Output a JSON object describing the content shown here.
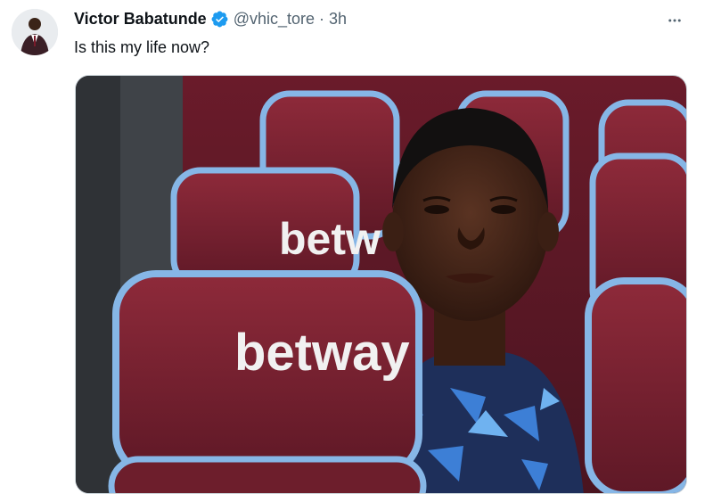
{
  "author": {
    "display_name": "Victor Babatunde",
    "handle": "@vhic_tore",
    "separator": "·",
    "timestamp": "3h",
    "verified_icon": "verified-badge-icon",
    "avatar": "avatar"
  },
  "tweet": {
    "text": "Is this my life now?"
  },
  "media": {
    "description_icon": "media-photo",
    "seat_branding_front": "betway",
    "seat_branding_back": "betw"
  },
  "more_icon": "more-dots-icon",
  "colors": {
    "verified_blue": "#1d9bf0",
    "text_primary": "#0f1419",
    "text_secondary": "#536471",
    "seat_maroon": "#7a1f2e",
    "seat_trim": "#86b6e6"
  }
}
